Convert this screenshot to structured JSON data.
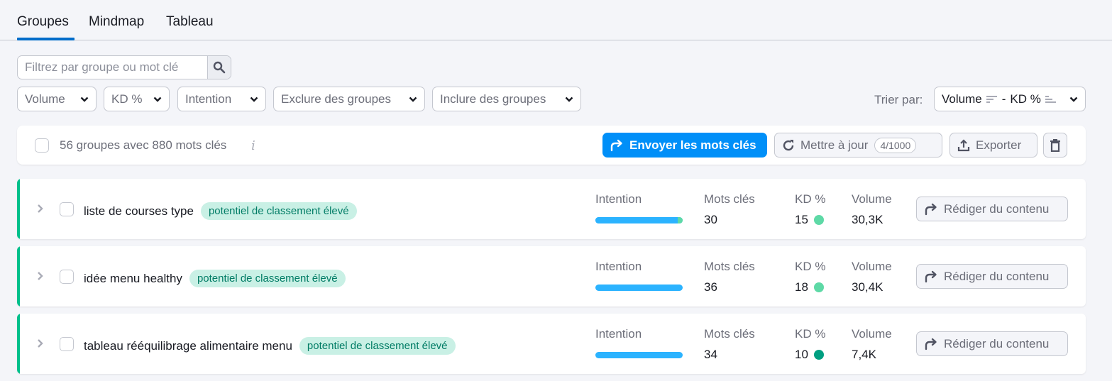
{
  "tabs": [
    {
      "label": "Groupes",
      "active": true
    },
    {
      "label": "Mindmap",
      "active": false
    },
    {
      "label": "Tableau",
      "active": false
    }
  ],
  "search": {
    "placeholder": "Filtrez par groupe ou mot clé",
    "value": "",
    "icon": "search-icon"
  },
  "filters": [
    {
      "label": "Volume"
    },
    {
      "label": "KD %"
    },
    {
      "label": "Intention"
    },
    {
      "label": "Exclure des groupes"
    },
    {
      "label": "Inclure des groupes"
    }
  ],
  "sort": {
    "label": "Trier par:",
    "primary": "Volume",
    "primary_direction": "descending",
    "separator": "-",
    "secondary": "KD %",
    "secondary_direction": "ascending"
  },
  "toolbar": {
    "summary": "56 groupes avec 880 mots clés",
    "info_icon": "i",
    "send_label": "Envoyer les mots clés",
    "update_label": "Mettre à jour",
    "update_quota": "4/1000",
    "export_label": "Exporter",
    "delete_icon": "trash-icon"
  },
  "colors": {
    "accent": "#006dca",
    "primary_button": "#008ff8",
    "group_border": "#00c08b",
    "tag_bg": "#c9f0e5",
    "tag_text": "#007c65",
    "intent_informational": "#2bb3ff",
    "intent_commercial": "#5ed9a6"
  },
  "metric_labels": {
    "intent": "Intention",
    "keywords": "Mots clés",
    "kd": "KD %",
    "volume": "Volume"
  },
  "groups": [
    {
      "name": "liste de courses type",
      "tag": "potentiel de classement élevé",
      "intent_segments": [
        {
          "type": "informational",
          "share": 0.94,
          "color": "#2bb3ff"
        },
        {
          "type": "commercial",
          "share": 0.06,
          "color": "#5ed9a6"
        }
      ],
      "keywords": "30",
      "kd": "15",
      "kd_color": "#5ed9a6",
      "volume": "30,3K",
      "action_label": "Rédiger du contenu"
    },
    {
      "name": "idée menu healthy",
      "tag": "potentiel de classement élevé",
      "intent_segments": [
        {
          "type": "informational",
          "share": 1.0,
          "color": "#2bb3ff"
        }
      ],
      "keywords": "36",
      "kd": "18",
      "kd_color": "#5ed9a6",
      "volume": "30,4K",
      "action_label": "Rédiger du contenu"
    },
    {
      "name": "tableau rééquilibrage alimentaire menu",
      "tag": "potentiel de classement élevé",
      "intent_segments": [
        {
          "type": "informational",
          "share": 1.0,
          "color": "#2bb3ff"
        }
      ],
      "keywords": "34",
      "kd": "10",
      "kd_color": "#009f81",
      "volume": "7,4K",
      "action_label": "Rédiger du contenu"
    }
  ]
}
